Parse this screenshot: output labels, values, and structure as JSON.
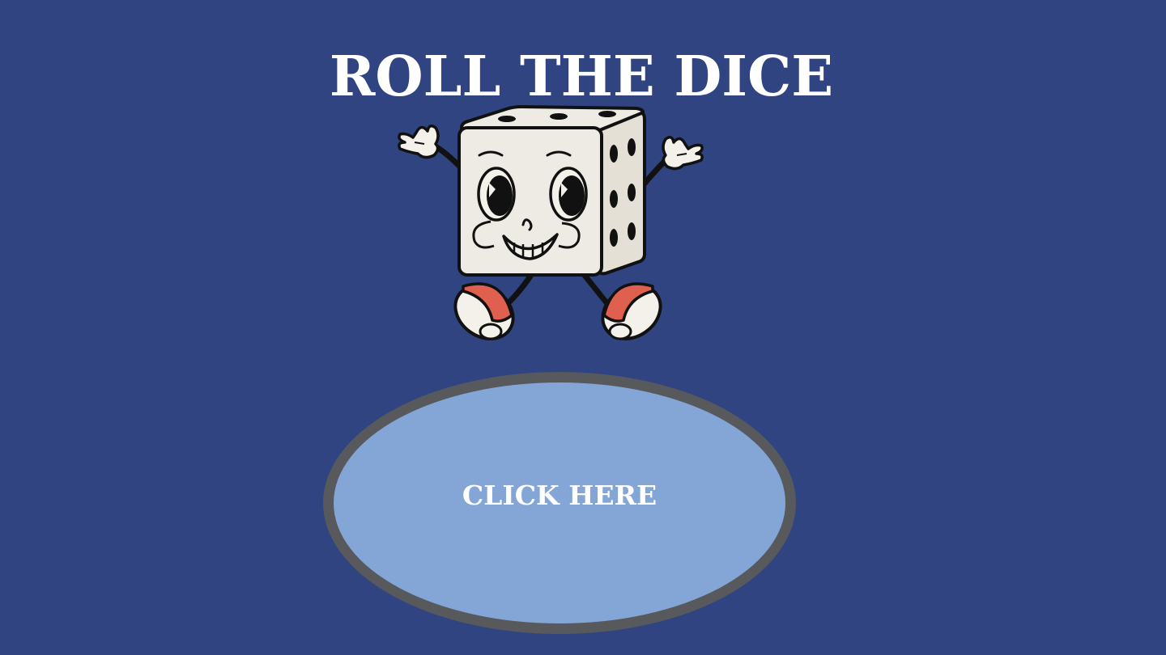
{
  "title": "ROLL THE DICE",
  "mascot": {
    "icon": "dice-mascot-icon"
  },
  "button": {
    "label": "CLICK HERE"
  },
  "colors": {
    "background": "#2f4480",
    "title_text": "#ffffff",
    "button_fill": "#84a6d6",
    "button_border": "#58595d",
    "button_text": "#ffffff",
    "dice_face": "#eeebe4",
    "shoe_red": "#e06050"
  }
}
